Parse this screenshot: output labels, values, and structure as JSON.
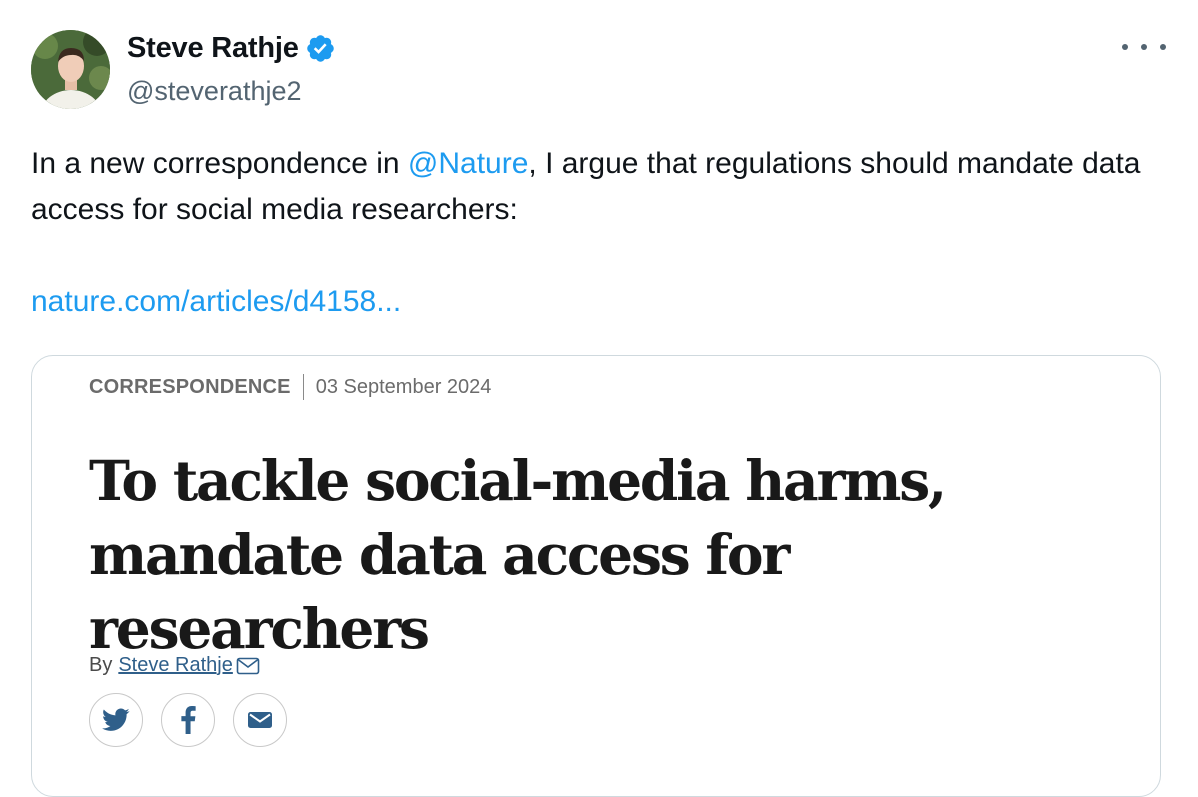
{
  "author": {
    "name": "Steve Rathje",
    "handle": "@steverathje2",
    "verified": true,
    "verified_color": "#1d9bf0"
  },
  "tweet": {
    "text_before_mention": "In a new correspondence in ",
    "mention": "@Nature",
    "text_after_mention": ", I argue that regulations should mandate data access for social media researchers:",
    "link": "nature.com/articles/d4158...",
    "link_color": "#1d9bf0"
  },
  "card": {
    "type": "CORRESPONDENCE",
    "date": "03 September 2024",
    "title_line1": "To tackle social-media harms,",
    "title_line2": "mandate data access for researchers",
    "byline_prefix": "By",
    "byline_author": "Steve Rathje",
    "share_icons": [
      "twitter-icon",
      "facebook-icon",
      "email-icon"
    ]
  },
  "icons": {
    "more": "more-options-icon",
    "verified": "verified-badge-icon",
    "author_mail": "mail-icon"
  }
}
